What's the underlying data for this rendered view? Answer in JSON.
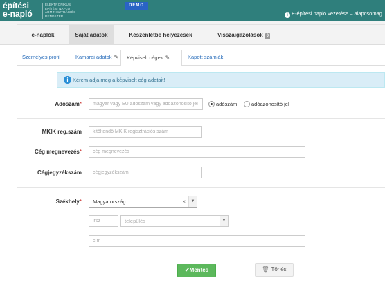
{
  "header": {
    "logo_line1": "építési",
    "logo_line2": "e-napló",
    "logo_sub": [
      "ELEKTRONIKUS",
      "ÉPÍTÉSI NAPLÓ",
      "ADMINISZTRÁCIÓS",
      "RENDSZER"
    ],
    "demo_label": "DEMO",
    "role_text": "E-építési napló vezetése – alapcsomag"
  },
  "main_nav": {
    "items": [
      {
        "label": "e-naplók"
      },
      {
        "label": "Saját adatok"
      },
      {
        "label": "Készenlétbe helyezések"
      },
      {
        "label": "Visszaigazolások"
      }
    ],
    "badge": "0"
  },
  "sub_tabs": [
    {
      "label": "Személyes profil"
    },
    {
      "label": "Kamarai adatok"
    },
    {
      "label": "Képviselt cégek"
    },
    {
      "label": "Kapott számlák"
    }
  ],
  "info_message": "Kérem adja meg a képviselt cég adatait!",
  "form": {
    "adoszam": {
      "label": "Adószám",
      "placeholder": "magyar vagy EU adószám vagy adóazonosító jel",
      "radio_options": [
        "adószám",
        "adóazonosító jel"
      ]
    },
    "mkik": {
      "label": "MKIK reg.szám",
      "placeholder": "kitöltendő MKIK regisztrációs szám"
    },
    "ceg_nev": {
      "label": "Cég megnevezés",
      "placeholder": "cég megnevezés"
    },
    "cegjegyzek": {
      "label": "Cégjegyzékszám",
      "placeholder": "cégjegyzékszám"
    },
    "szekhely": {
      "label": "Székhely",
      "country": "Magyarország",
      "zip_placeholder": "irsz",
      "city_placeholder": "település",
      "address_placeholder": "cím"
    },
    "required_mark": "*"
  },
  "buttons": {
    "save": "Mentés",
    "delete": "Törlés"
  },
  "colors": {
    "topbar": "#2f7f7c",
    "demo": "#2a63c5",
    "link": "#2a6ebb",
    "save": "#5cb85c",
    "info_bg": "#d9edf7"
  }
}
